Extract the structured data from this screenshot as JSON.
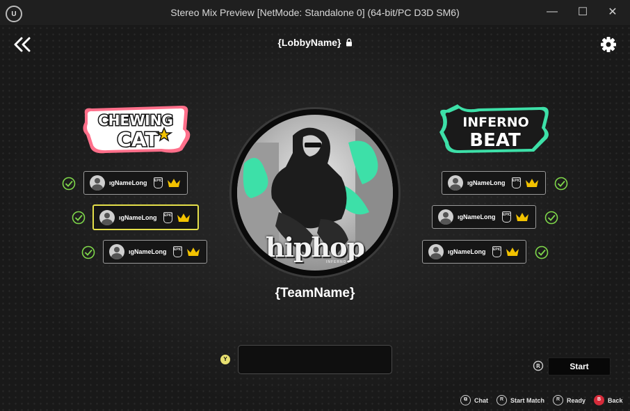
{
  "window": {
    "title": "Stereo Mix Preview [NetMode: Standalone 0]  (64-bit/PC D3D SM6)",
    "minimize": "—",
    "maximize": "☐",
    "close": "✕"
  },
  "lobby": {
    "name": "{LobbyName}",
    "team_name": "{TeamName}"
  },
  "teams": {
    "left": {
      "logo_line1": "CHEWING",
      "logo_line2": "CAT",
      "players": [
        {
          "name": "ıgNameLong",
          "platform": "EPIC",
          "ready": true,
          "selected": false
        },
        {
          "name": "ıgNameLong",
          "platform": "EPIC",
          "ready": true,
          "selected": true
        },
        {
          "name": "ıgNameLong",
          "platform": "EPIC",
          "ready": true,
          "selected": false
        }
      ]
    },
    "right": {
      "logo_line1": "INFERNO",
      "logo_line2": "BEAT",
      "players": [
        {
          "name": "ıgNameLong",
          "platform": "EPIC",
          "ready": true,
          "selected": false
        },
        {
          "name": "ıgNameLong",
          "platform": "EPIC",
          "ready": true,
          "selected": false
        },
        {
          "name": "ıgNameLong",
          "platform": "EPIC",
          "ready": true,
          "selected": false
        }
      ]
    }
  },
  "art": {
    "title": "hiphop",
    "subtitle": "INFERNO B"
  },
  "chat": {
    "key": "Y",
    "value": ""
  },
  "start": {
    "key": "R",
    "label": "Start"
  },
  "hints": [
    {
      "icon": "chat-key-icon",
      "key": "⧉",
      "label": "Chat"
    },
    {
      "icon": "start-match-key-icon",
      "key": "R",
      "label": "Start Match"
    },
    {
      "icon": "ready-key-icon",
      "key": "R",
      "label": "Ready"
    },
    {
      "icon": "back-key-icon",
      "key": "B",
      "label": "Back"
    }
  ],
  "colors": {
    "accent_green": "#3de0a8",
    "highlight_yellow": "#e5e04a",
    "crown": "#f2c200",
    "check": "#7fd84a",
    "logo_pink": "#ff6f8a",
    "back_red": "#d62b3a"
  }
}
